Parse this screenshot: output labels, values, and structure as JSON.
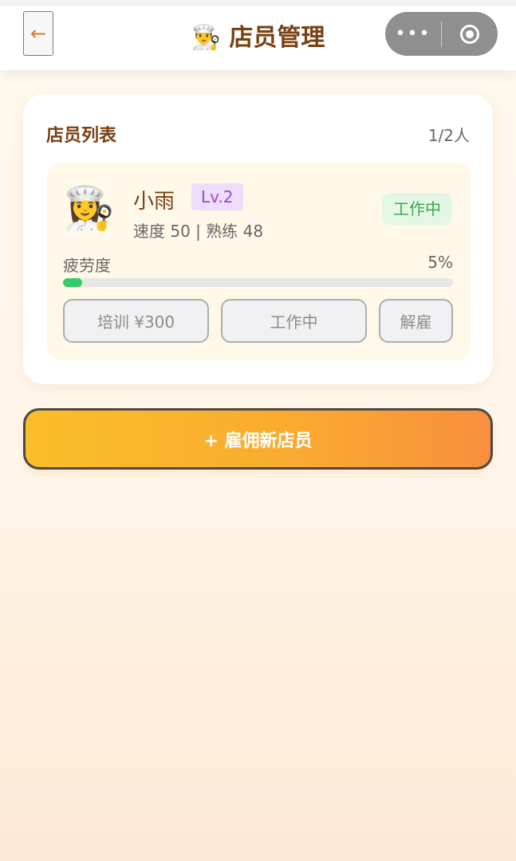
{
  "header": {
    "back_icon": "←",
    "title": "👨‍🍳 店员管理",
    "capsule_more": "•••"
  },
  "staff_list": {
    "title": "店员列表",
    "count": "1/2人",
    "staff": [
      {
        "avatar": "👩‍🍳",
        "name": "小雨",
        "level": "Lv.2",
        "stats": "速度 50 | 熟练 48",
        "status": "工作中",
        "fatigue_label": "疲劳度",
        "fatigue_percent_text": "5%",
        "fatigue_fraction": 0.05,
        "buttons": {
          "train": "培训 ¥300",
          "working": "工作中",
          "fire": "解雇"
        }
      }
    ]
  },
  "hire_button": "+ 雇佣新店员",
  "colors": {
    "accent": "#7a3f12",
    "status_green": "#3ba84c",
    "level_purple": "#9a4ad1",
    "hire_gradient_start": "#fbbe2a",
    "hire_gradient_end": "#f88f3e"
  }
}
